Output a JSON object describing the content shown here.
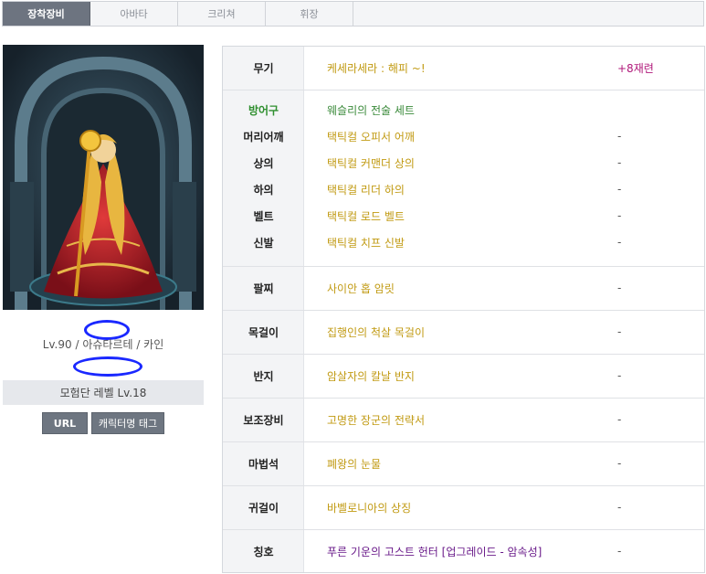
{
  "tabs": [
    {
      "label": "장착장비",
      "active": true
    },
    {
      "label": "아바타",
      "active": false
    },
    {
      "label": "크리쳐",
      "active": false
    },
    {
      "label": "휘장",
      "active": false
    }
  ],
  "character": {
    "level_line": "Lv.90 / 아슈타르테 / 카인",
    "adventure_level": "모험단 레벨 Lv.18"
  },
  "buttons": {
    "url": "URL",
    "tag": "캐릭터명 태그"
  },
  "equipment": {
    "weapon": {
      "slot": "무기",
      "name": "케세라세라 : 해피 ~!",
      "extra": "+8재련"
    },
    "armor_header": {
      "slot": "방어구",
      "name": "웨슬리의 전술 세트"
    },
    "armor": [
      {
        "slot": "머리어깨",
        "name": "택틱컬 오피서 어깨",
        "extra": "-"
      },
      {
        "slot": "상의",
        "name": "택틱컬 커맨더 상의",
        "extra": "-"
      },
      {
        "slot": "하의",
        "name": "택틱컬 리더 하의",
        "extra": "-"
      },
      {
        "slot": "벨트",
        "name": "택틱컬 로드 벨트",
        "extra": "-"
      },
      {
        "slot": "신발",
        "name": "택틱컬 치프 신발",
        "extra": "-"
      }
    ],
    "accessories": [
      {
        "slot": "팔찌",
        "name": "사이안 홉 암릿",
        "extra": "-"
      },
      {
        "slot": "목걸이",
        "name": "집행인의 척살 목걸이",
        "extra": "-"
      },
      {
        "slot": "반지",
        "name": "암살자의 칼날 반지",
        "extra": "-"
      },
      {
        "slot": "보조장비",
        "name": "고명한 장군의 전략서",
        "extra": "-"
      },
      {
        "slot": "마법석",
        "name": "폐왕의 눈물",
        "extra": "-"
      },
      {
        "slot": "귀걸이",
        "name": "바벨로니아의 상징",
        "extra": "-"
      },
      {
        "slot": "칭호",
        "name": "푸른 기운의 고스트 헌터 [업그레이드 - 암속성]",
        "extra": "-"
      }
    ]
  },
  "colors": {
    "item_gold": "#c19a12",
    "set_green": "#3a8a3a",
    "title_purple": "#6a1b8a",
    "reinforce_magenta": "#b0187a",
    "active_tab": "#6d7480"
  }
}
